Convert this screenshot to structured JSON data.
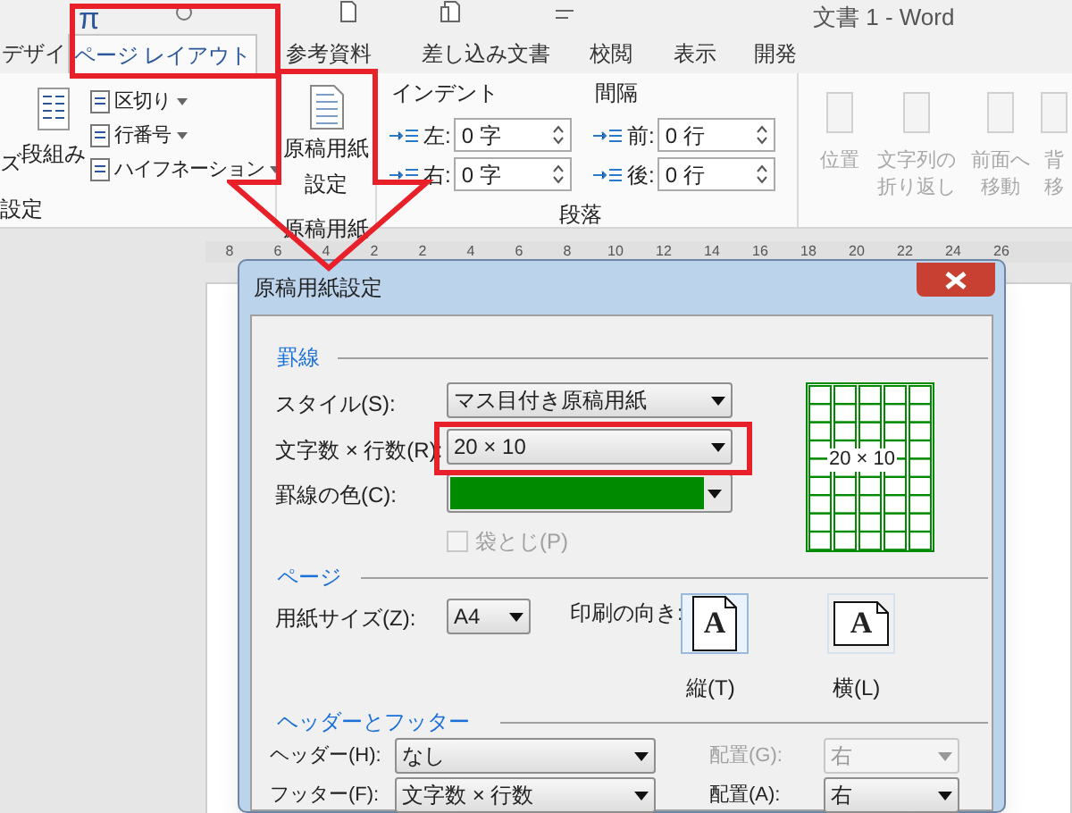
{
  "window": {
    "title": "文書 1 - Word"
  },
  "quick_access": {
    "equation_symbol": "π"
  },
  "ribbon_tabs": [
    {
      "label": "デザイ",
      "selected": false
    },
    {
      "label": "ページ レイアウト",
      "selected": true
    },
    {
      "label": "参考資料",
      "selected": false
    },
    {
      "label": "差し込み文書",
      "selected": false
    },
    {
      "label": "校閲",
      "selected": false
    },
    {
      "label": "表示",
      "selected": false
    },
    {
      "label": "開発",
      "selected": false
    }
  ],
  "page_setup_group": {
    "cut_label": "ズ",
    "columns_button": "段組み",
    "commands": [
      "区切り",
      "行番号",
      "ハイフネーション"
    ],
    "label": "設定"
  },
  "genko_group": {
    "button_lines": [
      "原稿用紙",
      "設定"
    ],
    "label": "原稿用紙"
  },
  "paragraph_group": {
    "indent_label": "インデント",
    "spacing_label": "間隔",
    "label": "段落",
    "indent_fields": [
      {
        "label": "左:",
        "value": "0 字"
      },
      {
        "label": "右:",
        "value": "0 字"
      }
    ],
    "spacing_fields": [
      {
        "label": "前:",
        "value": "0 行"
      },
      {
        "label": "後:",
        "value": "0 行"
      }
    ]
  },
  "arrange_group": {
    "buttons": [
      {
        "lines": [
          "位置"
        ],
        "disabled": true
      },
      {
        "lines": [
          "文字列の",
          "折り返し"
        ],
        "disabled": true
      },
      {
        "lines": [
          "前面へ",
          "移動"
        ],
        "disabled": true
      },
      {
        "lines": [
          "背",
          "移"
        ],
        "disabled": true
      }
    ]
  },
  "ruler": {
    "ticks": [
      "8",
      "6",
      "4",
      "2",
      "2",
      "4",
      "6",
      "8",
      "10",
      "12",
      "14",
      "16",
      "18",
      "20",
      "22",
      "24",
      "26"
    ]
  },
  "dialog": {
    "title": "原稿用紙設定",
    "grid_section": {
      "title": "罫線",
      "style_label": "スタイル(S):",
      "style_value": "マス目付き原稿用紙",
      "size_label": "文字数 × 行数(R):",
      "size_value": "20 × 10",
      "color_label": "罫線の色(C):",
      "color": "#008a00",
      "binding": {
        "label": "袋とじ(P)",
        "checked": false,
        "disabled": true
      },
      "preview_text": "20 × 10"
    },
    "page_section": {
      "title": "ページ",
      "paper_label": "用紙サイズ(Z):",
      "paper_value": "A4",
      "orientation_label": "印刷の向き:",
      "orientations": [
        {
          "label": "縦(T)",
          "kind": "portrait",
          "icon_letter": "A",
          "selected": true
        },
        {
          "label": "横(L)",
          "kind": "landscape",
          "icon_letter": "A",
          "selected": false
        }
      ]
    },
    "header_footer_section": {
      "title": "ヘッダーとフッター",
      "rows": [
        {
          "label": "ヘッダー(H):",
          "value": "なし",
          "align_label": "配置(G):",
          "align_value": "右",
          "align_disabled": true
        },
        {
          "label": "フッター(F):",
          "value": "文字数 × 行数",
          "align_label": "配置(A):",
          "align_value": "右",
          "align_disabled": false
        }
      ]
    }
  }
}
